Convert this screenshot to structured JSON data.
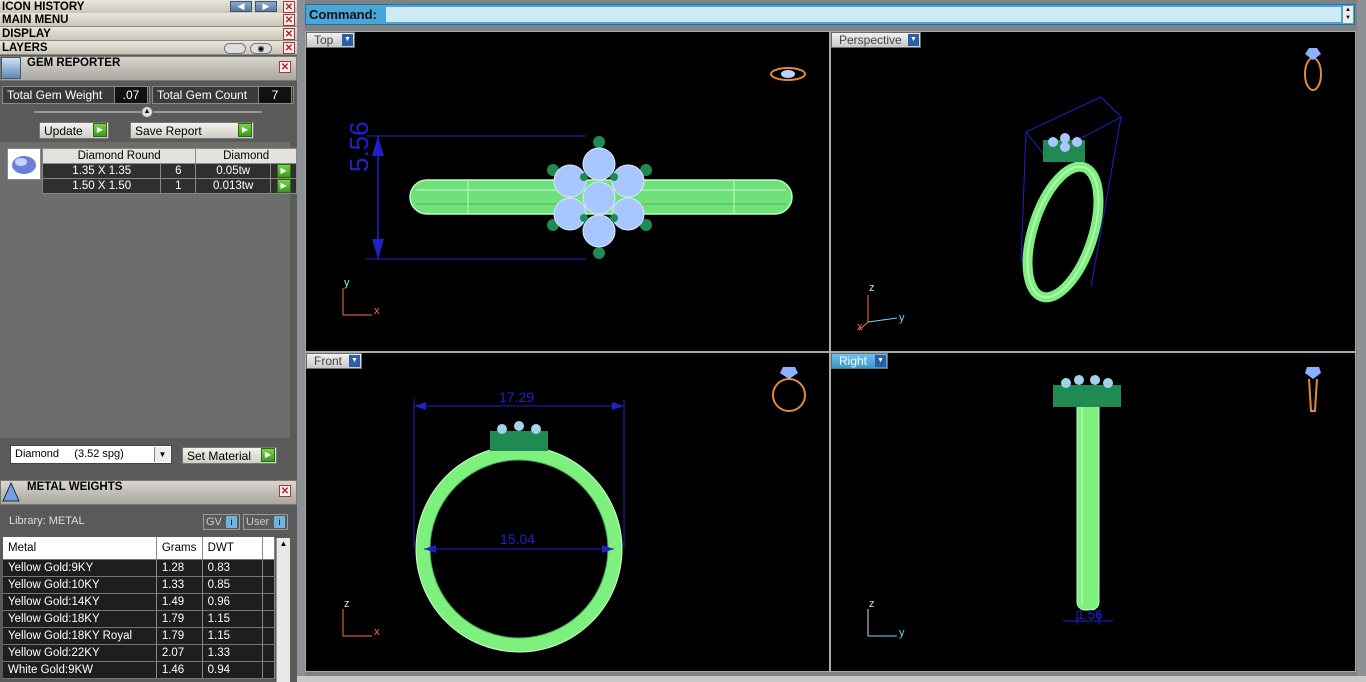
{
  "menus": {
    "icon_history": "ICON HISTORY",
    "main_menu": "MAIN MENU",
    "display": "DISPLAY",
    "layers": "LAYERS"
  },
  "gem_reporter": {
    "title": "GEM REPORTER",
    "total_weight_label": "Total Gem Weight",
    "total_weight_value": ".07",
    "total_count_label": "Total Gem Count",
    "total_count_value": "7",
    "update_label": "Update",
    "save_report_label": "Save Report",
    "table": {
      "headers": [
        "Diamond Round",
        "Diamond"
      ],
      "rows": [
        {
          "size": "1.35 X 1.35",
          "count": "6",
          "weight": "0.05tw"
        },
        {
          "size": "1.50 X 1.50",
          "count": "1",
          "weight": "0.013tw"
        }
      ]
    },
    "material_select": "Diamond     (3.52 spg)",
    "set_material_label": "Set Material"
  },
  "metal_weights": {
    "title": "METAL WEIGHTS",
    "library_label": "Library: METAL",
    "gv_label": "GV",
    "user_label": "User",
    "columns": [
      "Metal",
      "Grams",
      "DWT"
    ],
    "rows": [
      {
        "metal": "Yellow Gold:9KY",
        "grams": "1.28",
        "dwt": "0.83"
      },
      {
        "metal": "Yellow Gold:10KY",
        "grams": "1.33",
        "dwt": "0.85"
      },
      {
        "metal": "Yellow Gold:14KY",
        "grams": "1.49",
        "dwt": "0.96"
      },
      {
        "metal": "Yellow Gold:18KY",
        "grams": "1.79",
        "dwt": "1.15"
      },
      {
        "metal": "Yellow Gold:18KY Royal",
        "grams": "1.79",
        "dwt": "1.15"
      },
      {
        "metal": "Yellow Gold:22KY",
        "grams": "2.07",
        "dwt": "1.33"
      },
      {
        "metal": "White Gold:9KW",
        "grams": "1.46",
        "dwt": "0.94"
      }
    ]
  },
  "command": {
    "label": "Command:"
  },
  "viewports": {
    "top": {
      "label": "Top",
      "dimension": "5.56",
      "axis1": "y",
      "axis2": "x"
    },
    "perspective": {
      "label": "Perspective",
      "axis1": "z",
      "axis2": "y",
      "axis3": "x"
    },
    "front": {
      "label": "Front",
      "width_dim": "17.29",
      "inner_dim": "15.04",
      "axis1": "z",
      "axis2": "x"
    },
    "right": {
      "label": "Right",
      "thickness_dim": "1.56",
      "axis1": "z",
      "axis2": "y"
    }
  },
  "colors": {
    "ring_green": "#7df07d",
    "gem_blue": "#a9c7ff",
    "prong_green": "#1f8a52",
    "dimension_blue": "#2020c8",
    "accent_blue": "#48a7d6"
  }
}
